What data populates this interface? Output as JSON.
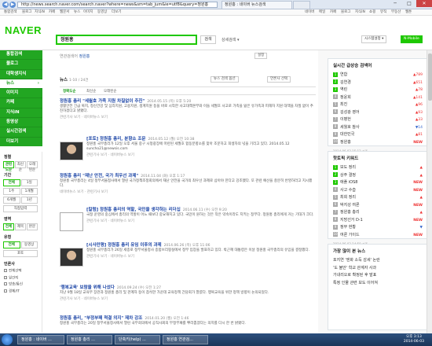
{
  "browser": {
    "url": "http://news.search.naver.com/search.naver?where=news&sm=tab_jum&ie=utf8&query=정원홍",
    "tabs": [
      "정원홍 : 네이버 뉴스검색",
      ""
    ],
    "back": "◀",
    "forward": "▶",
    "minimize": "─",
    "maximize": "□",
    "close": "✕"
  },
  "topmenu": {
    "left": [
      "통합검색",
      "블로그",
      "지식iN",
      "카페",
      "웹문서",
      "뉴스",
      "이미지",
      "동영상",
      "더보기"
    ],
    "right": [
      "네이버",
      "메일",
      "카페",
      "블로그",
      "지식iN",
      "쇼핑",
      "뮤직",
      "부동산",
      "웹툰"
    ]
  },
  "header": {
    "logo": "NAVER",
    "query": "정원홍",
    "search_label": "검색",
    "detail_search": "상세검색 ▾",
    "btn_search_settings": "시스템설정 ▾",
    "btn_mobile": "N-Mobile"
  },
  "leftnav": {
    "items": [
      "통합검색",
      "블로그",
      "대학생지식",
      "뉴스",
      "이미지",
      "카페",
      "지식iN",
      "동영상",
      "실시간검색",
      "더보기"
    ],
    "active_index": 3
  },
  "filters": {
    "period_title": "정렬",
    "sort_options": [
      "관련도순",
      "최신순",
      "오래된순"
    ],
    "range_title": "기간",
    "range_options": [
      "전체",
      "1일",
      "1주",
      "1개월",
      "6개월",
      "1년",
      "직접입력"
    ],
    "area_title": "영역",
    "area_options": [
      "전체",
      "제목",
      "본문"
    ],
    "type_title": "유형",
    "type_options": [
      "전체",
      "동영상",
      "포토"
    ],
    "source_title": "언론사",
    "source_checks": [
      "전체선택",
      "일간지",
      "방송/통신",
      "경제/IT"
    ]
  },
  "content": {
    "category": "연관검색어",
    "category_value": "정원홍",
    "settings": "설정",
    "news_label": "뉴스",
    "count": "1-10 / 24건",
    "sort_links": [
      "정확도순",
      "최신순",
      "오래된순"
    ],
    "dropdown1": "뉴스 검색 옵션",
    "dropdown2": "언론사 선택",
    "articles": [
      {
        "title": "정원홍 총리 \"세월호 가족 지원 차질없이 추진\"",
        "meta": "2014.05.15 (목) 오후 5:20",
        "body": "생활안전 긴급 복지, 정신건강 및 심리지원, 고용지원, 생계지원 등을 바로 시작한 사고대책본부와 이들 세월호 사고로 가족을 잃은 유가족과 피해자 지원 대책을 차질 없이 추진하겠다고 밝혔다.",
        "foot": "관련기사 보기 · 네이버뉴스 보기"
      },
      {
        "title": "[포토] 정원홍 총리, 분향소 조문",
        "meta": "2014.05.12 (월) 오전 10:38",
        "body": "정원홍 국무총리가 12일 오후 서울 중구 시청광장에 마련된 세월호 합동분향소를 찾아 조문하고 희생자의 넋을 기리고 있다. 2014.05.12 suncho21@newsis.com",
        "foot": "관련기사 보기 · 네이버뉴스 보기"
      },
      {
        "title": "정원홍 총리 \"재난 안전, 국가 최우선 과제\"",
        "meta": "2014.11.04 (화) 오후 1:17",
        "body": "정원홍 국무총리는 4일 정부서울청사에서 열린 국가정책조정회의에서 재난 안전을 국가의 최우선 과제로 삼아야 한다고 강조했다. 또 관련 예산을 충분히 반영하라고 지시했다.",
        "foot": "네이버뉴스 보기 · 관련기사 보기"
      },
      {
        "title": "[칼럼] 정원홍 총리의 역할, 국민을 생각하는 리더십",
        "meta": "2014.06.11 (수) 오전 9:20",
        "body": "국정 운영의 중심에서 총리의 역할이 어느 때보다 중요해지고 있다. 국민이 원하는 것은 작은 약속이라도 지키는 정부다. 정원홍 총리에게 거는 기대가 크다.",
        "foot": "관련기사 보기 · 네이버뉴스 보기"
      },
      {
        "title": "[시사만평] 정원홍 총리 유임 이후의 과제",
        "meta": "2014.06.26 (목) 오후 11:06",
        "body": "정원홍 국무총리가 26일 세종로 정부서울청사 종합브리핑실에서 정부 입장을 발표하고 있다. 박근혜 대통령은 이날 정원홍 국무총리의 유임을 결정했다.",
        "foot": "관련기사 보기 · 네이버뉴스 보기"
      },
      {
        "title": "'행복교육' 보람을 위해 나섰다",
        "meta": "2014.09.24 (수) 오전 1:27",
        "body": "지난 9월 18일 교육부 장관과 정원홍 총리 및 관계자 등이 참석한 가운데 교육정책 간담회가 열렸다. 행복교육을 위한 정책 방향이 논의되었다.",
        "foot": "관련기사 보기 · 네이버뉴스 보기"
      },
      {
        "title": "정원홍 총리, \"부정부패 척결 의지\" 재차 강조",
        "meta": "2014.01.20 (월) 오전 1:46",
        "body": "정원홍 국무총리는 20일 정부서울청사에서 열린 국무회의에서 공직사회의 부정부패를 뿌리뽑겠다는 의지를 다시 한 번 밝혔다.",
        "foot": "관련기사 보기 · 네이버뉴스 보기"
      }
    ]
  },
  "right": {
    "realtime_title": "실시간 급상승 검색어",
    "realtime_sub": "▾",
    "realtime": [
      {
        "rank": "1",
        "label": "연합",
        "delta": "▲789"
      },
      {
        "rank": "2",
        "label": "김연경",
        "delta": "▲651"
      },
      {
        "rank": "3",
        "label": "역린",
        "delta": "▲78"
      },
      {
        "rank": "4",
        "label": "정윤희",
        "delta": "▲141"
      },
      {
        "rank": "5",
        "label": "최진",
        "delta": "▲96"
      },
      {
        "rank": "6",
        "label": "김성광 영어",
        "delta": "▲93"
      },
      {
        "rank": "7",
        "label": "이병헌",
        "delta": "▲33"
      },
      {
        "rank": "8",
        "label": "세월호 참사",
        "delta": "▼14"
      },
      {
        "rank": "9",
        "label": "대한민국",
        "delta": "▲81"
      },
      {
        "rank": "10",
        "label": "정원홍",
        "delta": "NEW"
      }
    ],
    "realtime_time": "2014.06.03 15:12 기준",
    "hot_title": "핫토픽 키워드",
    "hot": [
      {
        "rank": "1",
        "label": "보도 정리",
        "delta": "▲"
      },
      {
        "rank": "2",
        "label": "상주 결정",
        "delta": "▲"
      },
      {
        "rank": "3",
        "label": "애플 iOS8",
        "delta": "NEW"
      },
      {
        "rank": "4",
        "label": "사고 수습",
        "delta": "NEW"
      },
      {
        "rank": "5",
        "label": "최희 정리",
        "delta": "▲"
      },
      {
        "rank": "6",
        "label": "박지성 여론",
        "delta": "NEW"
      },
      {
        "rank": "7",
        "label": "정원홍 총리",
        "delta": "▲"
      },
      {
        "rank": "8",
        "label": "지방선거 D-1",
        "delta": "NEW"
      },
      {
        "rank": "9",
        "label": "정부 현황",
        "delta": "▼"
      },
      {
        "rank": "10",
        "label": "여론 가이드",
        "delta": "NEW"
      }
    ],
    "hot_time": "2014.06.03 14:50 기준",
    "most_title": "가장 많이 본 뉴스",
    "most": [
      "포지연 '엔화 소득 감세' 논란",
      "'도 불안' 학교 관계자 사과",
      "가내리오로 확정된 후 발표",
      "특정 인물 관련 보도 이어져"
    ]
  },
  "taskbar": {
    "tasks": [
      "정원홍 : 네이버 ...",
      "정원홍 총리 ...",
      "단축키(help) ...",
      "정원홍 연관검..."
    ],
    "time": "오후 3:13",
    "date": "2014-06-03"
  }
}
